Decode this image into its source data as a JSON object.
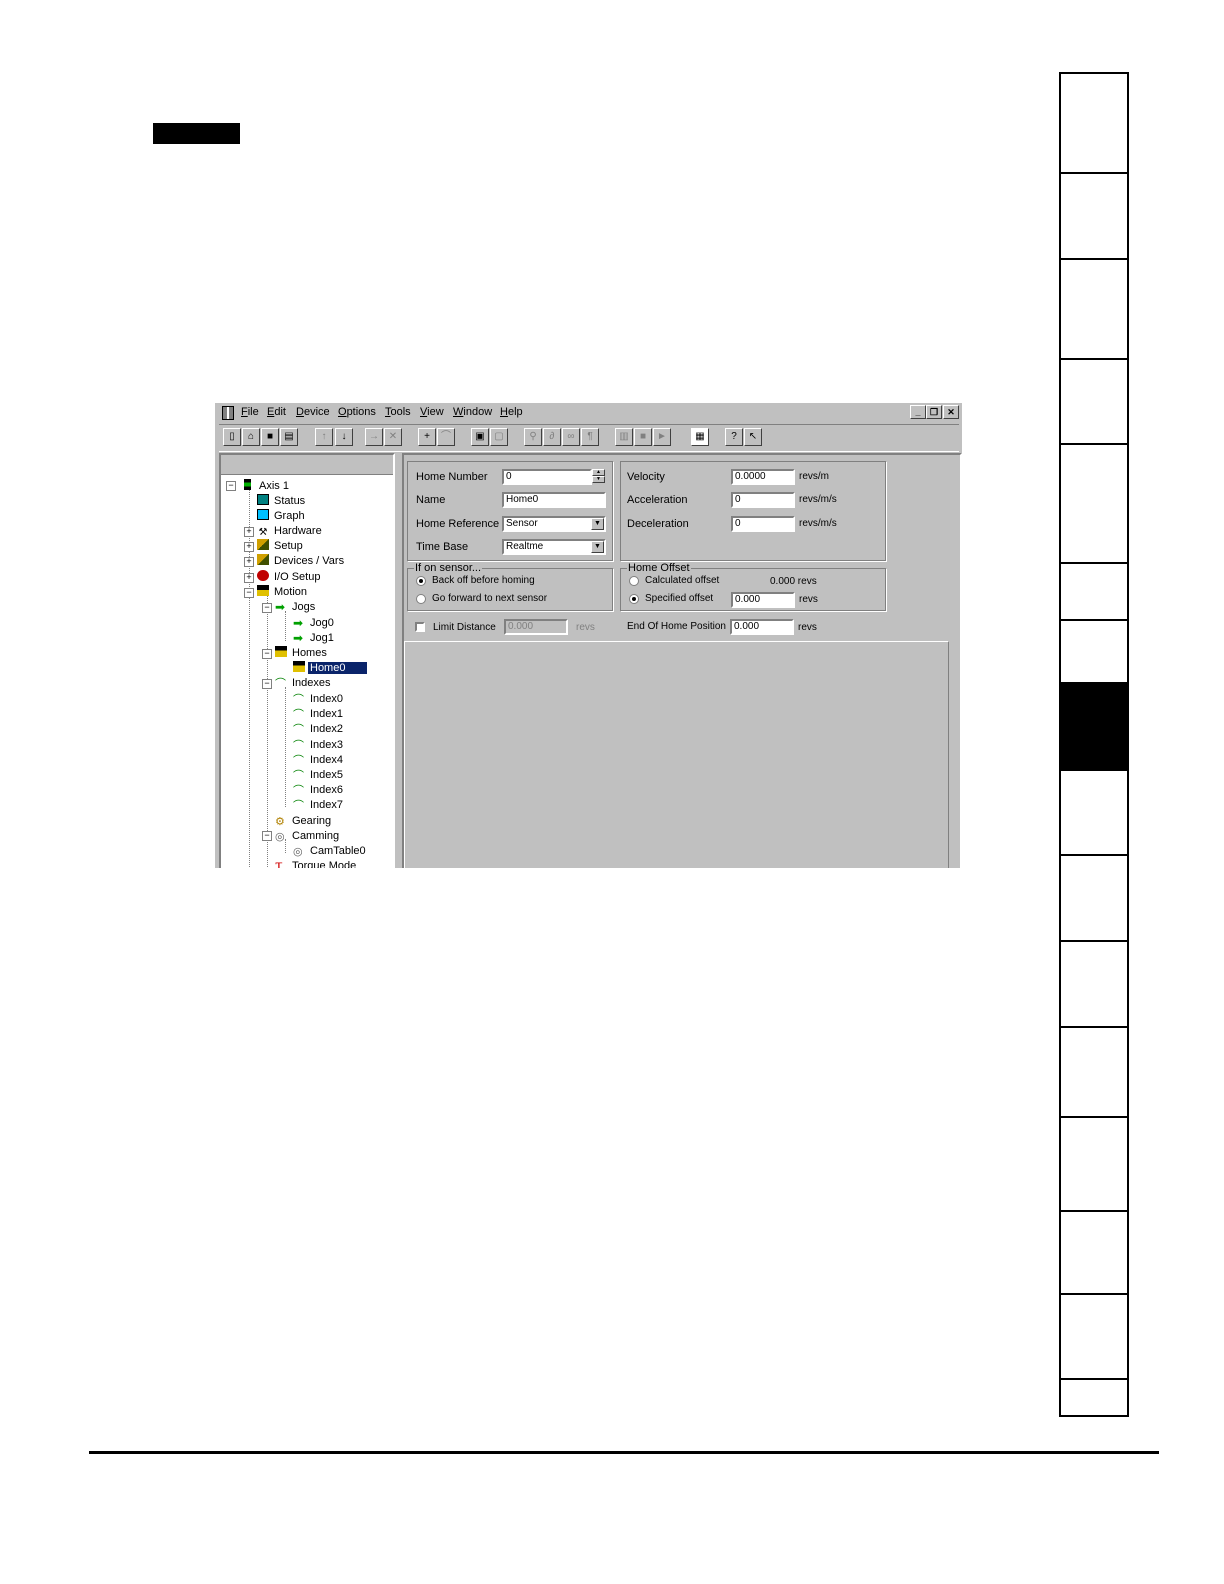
{
  "menu": {
    "items": [
      "File",
      "Edit",
      "Device",
      "Options",
      "Tools",
      "View",
      "Window",
      "Help"
    ]
  },
  "window_buttons": {
    "minimize": "_",
    "restore": "❐",
    "close": "✕"
  },
  "tree": {
    "nodes": [
      {
        "label": "Axis 1",
        "icon": "traffic-light-icon"
      },
      {
        "label": "Status",
        "icon": "monitor-icon"
      },
      {
        "label": "Graph",
        "icon": "graph-icon"
      },
      {
        "label": "Hardware",
        "icon": "wrench-icon"
      },
      {
        "label": "Setup",
        "icon": "setup-icon"
      },
      {
        "label": "Devices / Vars",
        "icon": "devices-icon"
      },
      {
        "label": "I/O Setup",
        "icon": "io-icon"
      },
      {
        "label": "Motion",
        "icon": "motion-icon"
      },
      {
        "label": "Jogs",
        "icon": "arrow-icon"
      },
      {
        "label": "Jog0",
        "icon": "arrow-icon"
      },
      {
        "label": "Jog1",
        "icon": "arrow-icon"
      },
      {
        "label": "Homes",
        "icon": "house-icon"
      },
      {
        "label": "Home0",
        "icon": "house-icon"
      },
      {
        "label": "Indexes",
        "icon": "index-icon"
      },
      {
        "label": "Index0",
        "icon": "index-icon"
      },
      {
        "label": "Index1",
        "icon": "index-icon"
      },
      {
        "label": "Index2",
        "icon": "index-icon"
      },
      {
        "label": "Index3",
        "icon": "index-icon"
      },
      {
        "label": "Index4",
        "icon": "index-icon"
      },
      {
        "label": "Index5",
        "icon": "index-icon"
      },
      {
        "label": "Index6",
        "icon": "index-icon"
      },
      {
        "label": "Index7",
        "icon": "index-icon"
      },
      {
        "label": "Gearing",
        "icon": "gear-icon"
      },
      {
        "label": "Camming",
        "icon": "cam-icon"
      },
      {
        "label": "CamTable0",
        "icon": "cam-icon"
      },
      {
        "label": "Torque Mode",
        "icon": "tau-icon"
      }
    ],
    "expanders": {
      "minus": "−",
      "plus": "+"
    },
    "tau_glyph": "τ"
  },
  "form": {
    "home_number_label": "Home Number",
    "home_number_value": "0",
    "name_label": "Name",
    "name_value": "Home0",
    "home_reference_label": "Home Reference",
    "home_reference_value": "Sensor",
    "time_base_label": "Time Base",
    "time_base_value": "Realtme",
    "velocity_label": "Velocity",
    "velocity_value": "0.0000",
    "velocity_unit": "revs/m",
    "acceleration_label": "Acceleration",
    "acceleration_value": "0",
    "acceleration_unit": "revs/m/s",
    "deceleration_label": "Deceleration",
    "deceleration_value": "0",
    "deceleration_unit": "revs/m/s",
    "if_on_sensor_title": "If on sensor...",
    "back_off_label": "Back off before homing",
    "go_forward_label": "Go forward to next sensor",
    "home_offset_title": "Home Offset",
    "calculated_offset_label": "Calculated offset",
    "calculated_offset_value": "0.000 revs",
    "specified_offset_label": "Specified offset",
    "specified_offset_value": "0.000",
    "specified_offset_unit": "revs",
    "limit_distance_label": "Limit Distance",
    "limit_distance_value": "0.000",
    "limit_distance_unit": "revs",
    "end_home_label": "End Of Home Position",
    "end_home_value": "0.000",
    "end_home_unit": "revs"
  }
}
